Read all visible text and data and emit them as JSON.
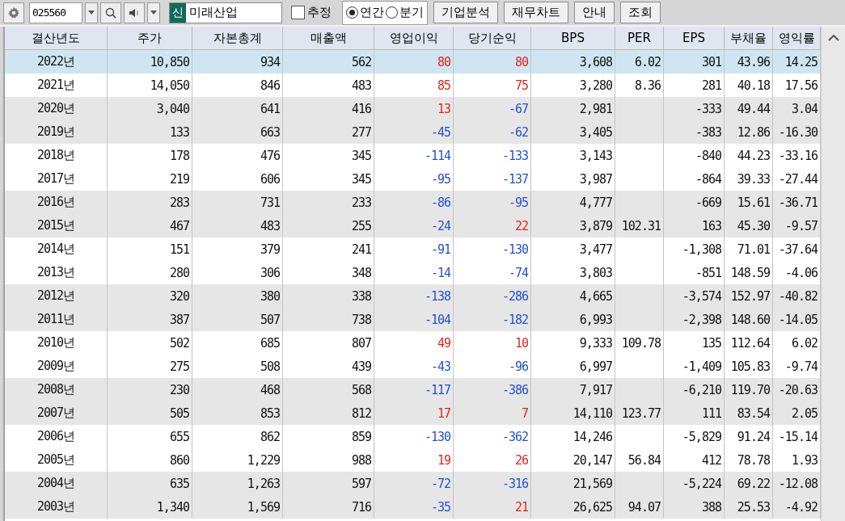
{
  "toolbar": {
    "code": "025560",
    "badge": "신",
    "company": "미래산업",
    "estimate": {
      "label": "추정",
      "checked": false
    },
    "periods": [
      {
        "label": "연간",
        "selected": true
      },
      {
        "label": "분기",
        "selected": false
      }
    ],
    "buttons": [
      "기업분석",
      "재무차트",
      "안내",
      "조회"
    ]
  },
  "table": {
    "columns": [
      "결산년도",
      "주가",
      "자본총계",
      "매출액",
      "영업이익",
      "당기순익",
      "BPS",
      "PER",
      "EPS",
      "부채율",
      "영익률"
    ],
    "rows": [
      {
        "selected": true,
        "cells": [
          "2022년",
          "10,850",
          "934",
          "562",
          {
            "text": "80",
            "color": "#e8231c"
          },
          {
            "text": "80",
            "color": "#e8231c"
          },
          "3,608",
          "6.02",
          "301",
          "43.96",
          "14.25"
        ]
      },
      {
        "selected": false,
        "cells": [
          "2021년",
          "14,050",
          "846",
          "483",
          {
            "text": "85",
            "color": "#e8231c"
          },
          {
            "text": "75",
            "color": "#e8231c"
          },
          "3,280",
          "8.36",
          "281",
          "40.18",
          "17.56"
        ]
      },
      {
        "selected": false,
        "cells": [
          "2020년",
          "3,040",
          "641",
          "416",
          {
            "text": "13",
            "color": "#e8231c"
          },
          {
            "text": "-67",
            "color": "#2450d0"
          },
          "2,981",
          "",
          "-333",
          "49.44",
          "3.04"
        ]
      },
      {
        "selected": false,
        "cells": [
          "2019년",
          "133",
          "663",
          "277",
          {
            "text": "-45",
            "color": "#2450d0"
          },
          {
            "text": "-62",
            "color": "#2450d0"
          },
          "3,405",
          "",
          "-383",
          "12.86",
          "-16.30"
        ]
      },
      {
        "selected": false,
        "cells": [
          "2018년",
          "178",
          "476",
          "345",
          {
            "text": "-114",
            "color": "#2450d0"
          },
          {
            "text": "-133",
            "color": "#2450d0"
          },
          "3,143",
          "",
          "-840",
          "44.23",
          "-33.16"
        ]
      },
      {
        "selected": false,
        "cells": [
          "2017년",
          "219",
          "606",
          "345",
          {
            "text": "-95",
            "color": "#2450d0"
          },
          {
            "text": "-137",
            "color": "#2450d0"
          },
          "3,987",
          "",
          "-864",
          "39.33",
          "-27.44"
        ]
      },
      {
        "selected": false,
        "cells": [
          "2016년",
          "283",
          "731",
          "233",
          {
            "text": "-86",
            "color": "#2450d0"
          },
          {
            "text": "-95",
            "color": "#2450d0"
          },
          "4,777",
          "",
          "-669",
          "15.61",
          "-36.71"
        ]
      },
      {
        "selected": false,
        "cells": [
          "2015년",
          "467",
          "483",
          "255",
          {
            "text": "-24",
            "color": "#2450d0"
          },
          {
            "text": "22",
            "color": "#e8231c"
          },
          "3,879",
          "102.31",
          "163",
          "45.30",
          "-9.57"
        ]
      },
      {
        "selected": false,
        "cells": [
          "2014년",
          "151",
          "379",
          "241",
          {
            "text": "-91",
            "color": "#2450d0"
          },
          {
            "text": "-130",
            "color": "#2450d0"
          },
          "3,477",
          "",
          "-1,308",
          "71.01",
          "-37.64"
        ]
      },
      {
        "selected": false,
        "cells": [
          "2013년",
          "280",
          "306",
          "348",
          {
            "text": "-14",
            "color": "#2450d0"
          },
          {
            "text": "-74",
            "color": "#2450d0"
          },
          "3,803",
          "",
          "-851",
          "148.59",
          "-4.06"
        ]
      },
      {
        "selected": false,
        "cells": [
          "2012년",
          "320",
          "380",
          "338",
          {
            "text": "-138",
            "color": "#2450d0"
          },
          {
            "text": "-286",
            "color": "#2450d0"
          },
          "4,665",
          "",
          "-3,574",
          "152.97",
          "-40.82"
        ]
      },
      {
        "selected": false,
        "cells": [
          "2011년",
          "387",
          "507",
          "738",
          {
            "text": "-104",
            "color": "#2450d0"
          },
          {
            "text": "-182",
            "color": "#2450d0"
          },
          "6,993",
          "",
          "-2,398",
          "148.60",
          "-14.05"
        ]
      },
      {
        "selected": false,
        "cells": [
          "2010년",
          "502",
          "685",
          "807",
          {
            "text": "49",
            "color": "#e8231c"
          },
          {
            "text": "10",
            "color": "#e8231c"
          },
          "9,333",
          "109.78",
          "135",
          "112.64",
          "6.02"
        ]
      },
      {
        "selected": false,
        "cells": [
          "2009년",
          "275",
          "508",
          "439",
          {
            "text": "-43",
            "color": "#2450d0"
          },
          {
            "text": "-96",
            "color": "#2450d0"
          },
          "6,997",
          "",
          "-1,409",
          "105.83",
          "-9.74"
        ]
      },
      {
        "selected": false,
        "cells": [
          "2008년",
          "230",
          "468",
          "568",
          {
            "text": "-117",
            "color": "#2450d0"
          },
          {
            "text": "-386",
            "color": "#2450d0"
          },
          "7,917",
          "",
          "-6,210",
          "119.70",
          "-20.63"
        ]
      },
      {
        "selected": false,
        "cells": [
          "2007년",
          "505",
          "853",
          "812",
          {
            "text": "17",
            "color": "#e8231c"
          },
          {
            "text": "7",
            "color": "#e8231c"
          },
          "14,110",
          "123.77",
          "111",
          "83.54",
          "2.05"
        ]
      },
      {
        "selected": false,
        "cells": [
          "2006년",
          "655",
          "862",
          "859",
          {
            "text": "-130",
            "color": "#2450d0"
          },
          {
            "text": "-362",
            "color": "#2450d0"
          },
          "14,246",
          "",
          "-5,829",
          "91.24",
          "-15.14"
        ]
      },
      {
        "selected": false,
        "cells": [
          "2005년",
          "860",
          "1,229",
          "988",
          {
            "text": "19",
            "color": "#e8231c"
          },
          {
            "text": "26",
            "color": "#e8231c"
          },
          "20,147",
          "56.84",
          "412",
          "78.78",
          "1.93"
        ]
      },
      {
        "selected": false,
        "cells": [
          "2004년",
          "635",
          "1,263",
          "597",
          {
            "text": "-72",
            "color": "#2450d0"
          },
          {
            "text": "-316",
            "color": "#2450d0"
          },
          "21,569",
          "",
          "-5,224",
          "69.22",
          "-12.08"
        ]
      },
      {
        "selected": false,
        "cells": [
          "2003년",
          "1,340",
          "1,569",
          "716",
          {
            "text": "-35",
            "color": "#2450d0"
          },
          {
            "text": "21",
            "color": "#e8231c"
          },
          "26,625",
          "94.07",
          "388",
          "25.53",
          "-4.92"
        ]
      }
    ]
  }
}
